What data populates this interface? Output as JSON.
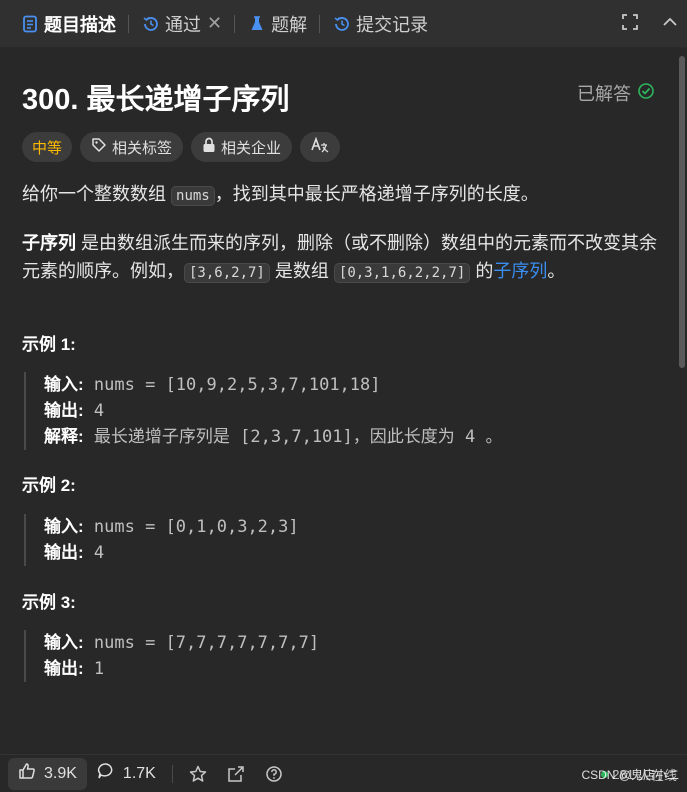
{
  "tabs": [
    {
      "label": "题目描述",
      "icon": "document-icon",
      "active": true
    },
    {
      "label": "通过",
      "icon": "history-icon",
      "closable": true
    },
    {
      "label": "题解",
      "icon": "flask-icon"
    },
    {
      "label": "提交记录",
      "icon": "history-icon"
    }
  ],
  "problem": {
    "title": "300. 最长递增子序列",
    "status": "已解答",
    "difficulty": "中等",
    "tags": [
      "相关标签",
      "相关企业"
    ],
    "desc_prefix": "给你一个整数数组",
    "desc_code": "nums",
    "desc_suffix": "，找到其中最长严格递增子序列的长度。",
    "def_bold": "子序列",
    "def_text1": "是由数组派生而来的序列，删除（或不删除）数组中的元素而不改变其余元素的顺序。例如，",
    "def_code1": "[3,6,2,7]",
    "def_text2": "是数组",
    "def_code2": "[0,3,1,6,2,2,7]",
    "def_text3": "的",
    "def_link": "子序列",
    "def_end": "。"
  },
  "examples": [
    {
      "heading": "示例 1:",
      "input_label": "输入:",
      "input": "nums = [10,9,2,5,3,7,101,18]",
      "output_label": "输出:",
      "output": "4",
      "explain_label": "解释:",
      "explain_a": "最长递增子序列是",
      "explain_code": "[2,3,7,101]",
      "explain_b": "，因此长度为",
      "explain_num": "4",
      "explain_c": "。"
    },
    {
      "heading": "示例 2:",
      "input_label": "输入:",
      "input": "nums = [0,1,0,3,2,3]",
      "output_label": "输出:",
      "output": "4"
    },
    {
      "heading": "示例 3:",
      "input_label": "输入:",
      "input": "nums = [7,7,7,7,7,7,7]",
      "output_label": "输出:",
      "output": "1"
    }
  ],
  "footer": {
    "likes": "3.9K",
    "comments": "1.7K",
    "online_count": "281",
    "online_label": "人在线"
  },
  "watermark": "CSDN @鬼店小二"
}
